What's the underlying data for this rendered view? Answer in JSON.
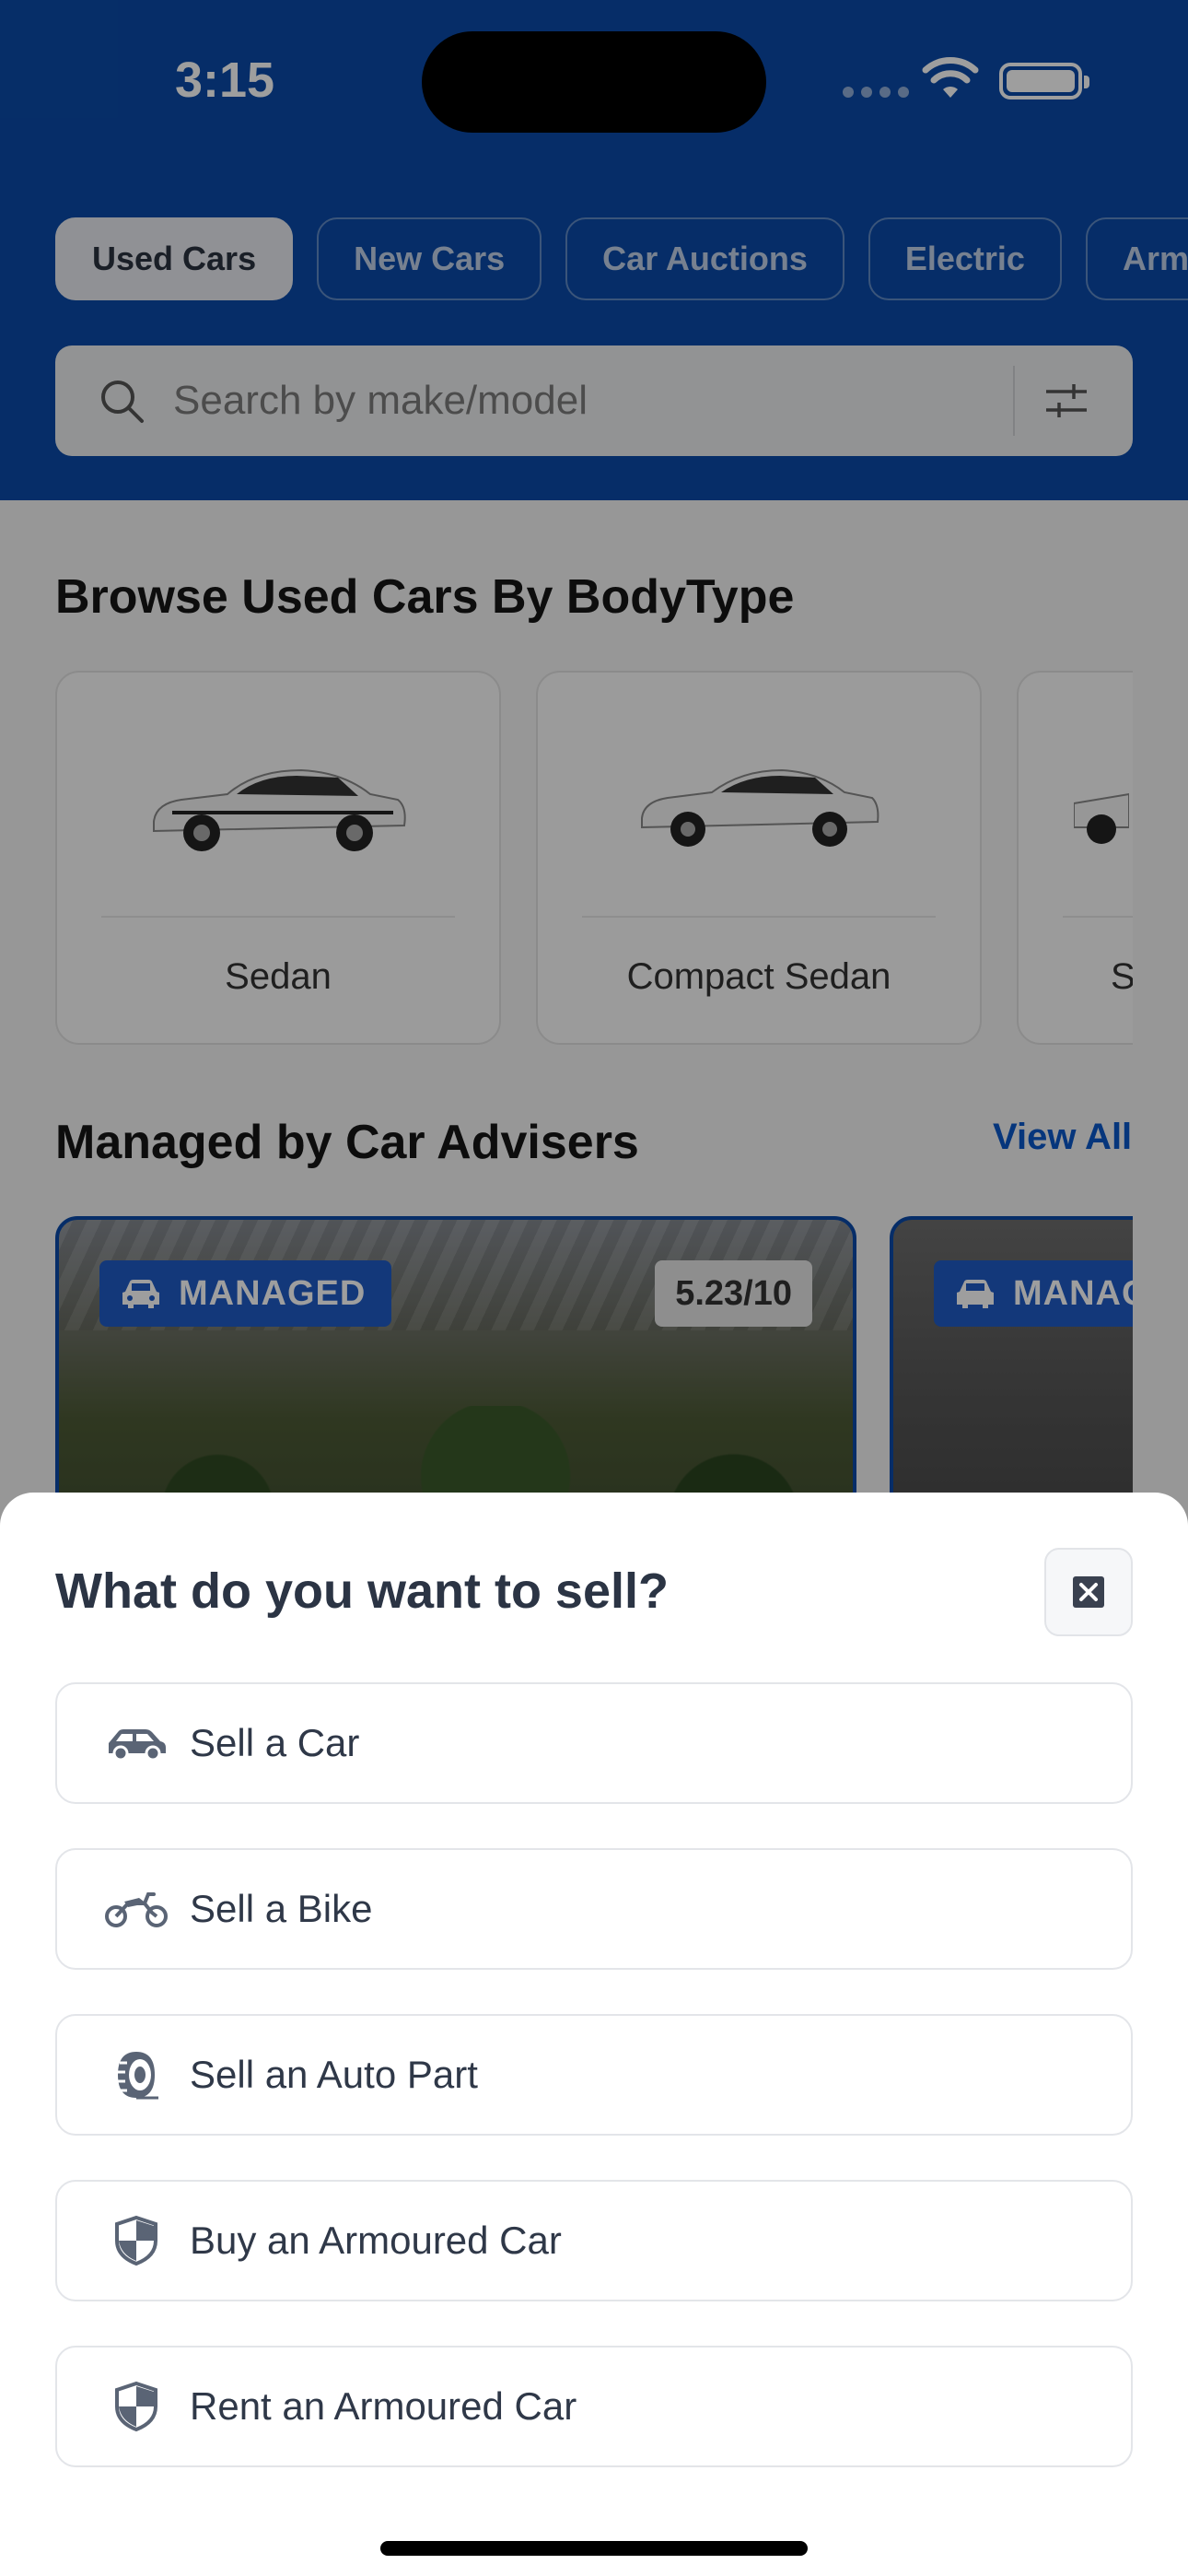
{
  "status": {
    "time": "3:15"
  },
  "tabs": [
    {
      "label": "Used Cars"
    },
    {
      "label": "New Cars"
    },
    {
      "label": "Car Auctions"
    },
    {
      "label": "Electric"
    },
    {
      "label": "Arm"
    }
  ],
  "search": {
    "placeholder": "Search by make/model"
  },
  "body_types": {
    "title": "Browse Used Cars By BodyType",
    "items": [
      {
        "label": "Sedan"
      },
      {
        "label": "Compact Sedan"
      },
      {
        "label": "S"
      }
    ]
  },
  "managed": {
    "title": "Managed by Car Advisers",
    "view_all": "View All",
    "cards": [
      {
        "badge": "MANAGED",
        "rating": "5.23/10"
      },
      {
        "badge": "MANAG"
      }
    ]
  },
  "sheet": {
    "title": "What do you want to sell?",
    "options": [
      {
        "label": "Sell a Car",
        "icon": "car-icon"
      },
      {
        "label": "Sell a Bike",
        "icon": "motorbike-icon"
      },
      {
        "label": "Sell an Auto Part",
        "icon": "tire-icon"
      },
      {
        "label": "Buy an Armoured Car",
        "icon": "shield-icon"
      },
      {
        "label": "Rent an Armoured Car",
        "icon": "shield-icon"
      }
    ]
  },
  "colors": {
    "brand": "#0a4aa8",
    "accent": "#0a57c9",
    "badge": "#1f5bc6"
  }
}
